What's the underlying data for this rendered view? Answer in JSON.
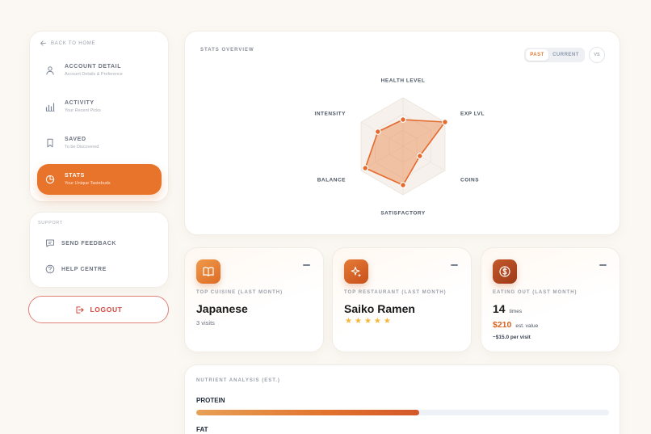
{
  "sidebar": {
    "back_label": "BACK TO HOME",
    "items": [
      {
        "title": "ACCOUNT DETAIL",
        "subtitle": "Account Details & Preference",
        "icon": "user-icon"
      },
      {
        "title": "ACTIVITY",
        "subtitle": "Your Recent Picks",
        "icon": "bar-chart-icon"
      },
      {
        "title": "SAVED",
        "subtitle": "To be Discovered",
        "icon": "bookmark-icon"
      },
      {
        "title": "STATS",
        "subtitle": "Your Unique Tastebuds",
        "icon": "pie-chart-icon",
        "active": true
      }
    ]
  },
  "support": {
    "label": "SUPPORT",
    "items": [
      {
        "title": "SEND FEEDBACK",
        "icon": "message-icon"
      },
      {
        "title": "HELP CENTRE",
        "icon": "help-circle-icon"
      }
    ]
  },
  "logout_label": "LOGOUT",
  "stats": {
    "title": "STATS OVERVIEW",
    "toggle": {
      "past": "PAST",
      "current": "CURRENT",
      "selected": "PAST"
    },
    "vs_label": "VS",
    "radar": {
      "axes": [
        "HEALTH LEVEL",
        "EXP LVL",
        "COINS",
        "SATISFACTORY",
        "BALANCE",
        "INTENSITY"
      ],
      "values": [
        0.55,
        1.0,
        0.4,
        0.8,
        0.9,
        0.6
      ],
      "fill_color": "#e8742c",
      "stroke_color": "#e46a2e"
    }
  },
  "metrics": {
    "cuisine": {
      "icon": "book-icon",
      "label": "TOP CUISINE (LAST MONTH)",
      "value": "Japanese",
      "sub": "3 visits"
    },
    "restaurant": {
      "icon": "sparkle-icon",
      "label": "TOP RESTAURANT (LAST MONTH)",
      "value": "Saiko Ramen",
      "rating": 5
    },
    "eating_out": {
      "icon": "dollar-icon",
      "label": "EATING OUT (LAST MONTH)",
      "count": "14",
      "count_unit": "times",
      "money": "$210",
      "money_note": "est. value",
      "per_visit": "~$15.0 per visit"
    }
  },
  "nutrients": {
    "title": "NUTRIENT ANALYSIS (EST.)",
    "items": [
      {
        "name": "PROTEIN",
        "fraction": 0.54
      },
      {
        "name": "FAT"
      }
    ]
  },
  "colors": {
    "accent": "#e8742c",
    "logout": "#d1493f",
    "star": "#f4b73c"
  }
}
